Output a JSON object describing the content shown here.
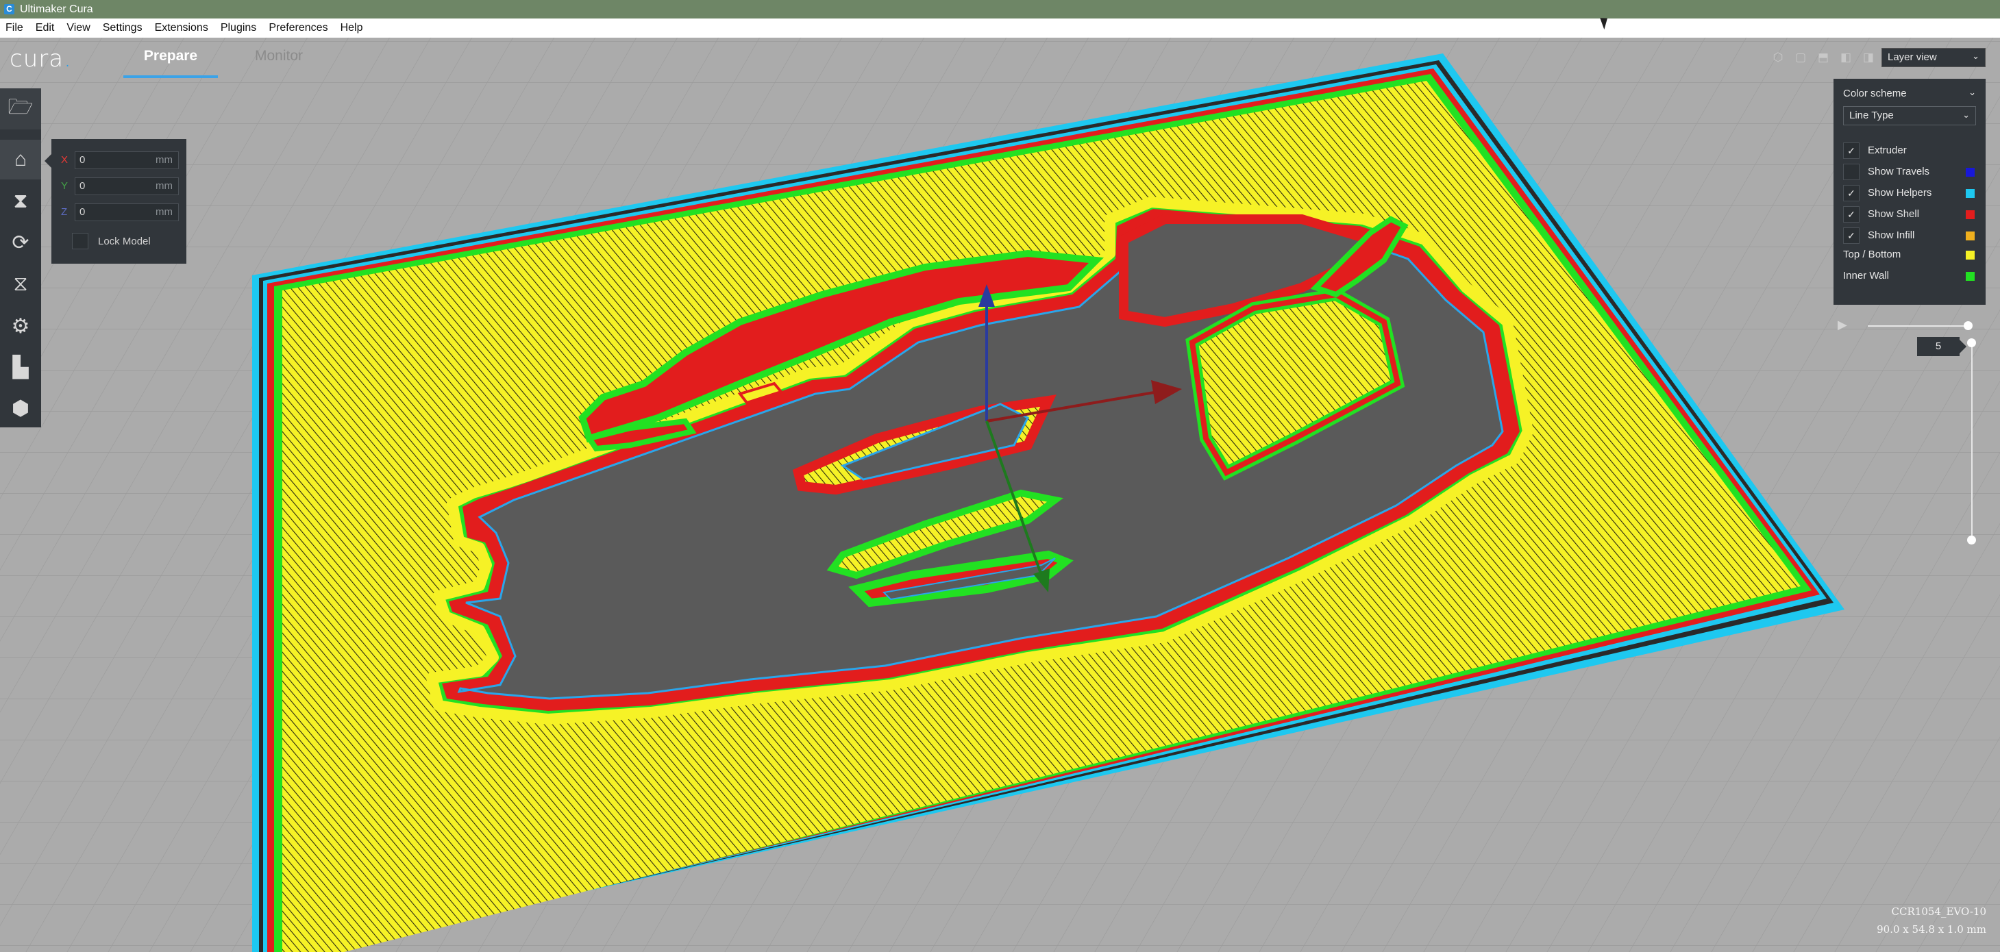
{
  "window": {
    "title": "Ultimaker Cura",
    "app_icon": "C"
  },
  "menu": [
    "File",
    "Edit",
    "View",
    "Settings",
    "Extensions",
    "Plugins",
    "Preferences",
    "Help"
  ],
  "header": {
    "logo": "cura",
    "tabs": [
      {
        "label": "Prepare",
        "active": true
      },
      {
        "label": "Monitor",
        "active": false
      }
    ]
  },
  "toolbar": {
    "tools": [
      {
        "name": "open-file",
        "icon": "folder-icon"
      },
      {
        "name": "move",
        "icon": "move-tool-icon",
        "active": true
      },
      {
        "name": "scale",
        "icon": "scale-tool-icon"
      },
      {
        "name": "rotate",
        "icon": "rotate-tool-icon"
      },
      {
        "name": "mirror",
        "icon": "mirror-tool-icon"
      },
      {
        "name": "per-model-settings",
        "icon": "per-model-settings-icon"
      },
      {
        "name": "support-blocker",
        "icon": "support-blocker-icon"
      },
      {
        "name": "print",
        "icon": "print-icon"
      }
    ]
  },
  "move_panel": {
    "x": {
      "label": "X",
      "value": "0",
      "unit": "mm",
      "color": "#e53935"
    },
    "y": {
      "label": "Y",
      "value": "0",
      "unit": "mm",
      "color": "#43a047"
    },
    "z": {
      "label": "Z",
      "value": "0",
      "unit": "mm",
      "color": "#3f51b5"
    },
    "lock_label": "Lock Model"
  },
  "view": {
    "selected": "Layer view"
  },
  "color_panel": {
    "header": "Color scheme",
    "scheme": "Line Type",
    "items": [
      {
        "label": "Extruder",
        "checked": true,
        "color": ""
      },
      {
        "label": "Show Travels",
        "checked": false,
        "color": "#1818d8"
      },
      {
        "label": "Show Helpers",
        "checked": true,
        "color": "#1ec8f0"
      },
      {
        "label": "Show Shell",
        "checked": true,
        "color": "#e21d1d"
      },
      {
        "label": "Show Infill",
        "checked": true,
        "color": "#f0b01e"
      }
    ],
    "legend": [
      {
        "label": "Top / Bottom",
        "color": "#f6f226"
      },
      {
        "label": "Inner Wall",
        "color": "#22e122"
      }
    ]
  },
  "layer_slider": {
    "current_layer": "5"
  },
  "object_info": {
    "name": "CCR1054_EVO-10",
    "dimensions": "90.0 x 54.8 x 1.0 mm"
  },
  "colors": {
    "accent": "#3ba3e8",
    "panel": "#31363b",
    "infill": "#f6f226",
    "shell": "#e21d1d",
    "inner_wall": "#22e122",
    "helpers": "#1ec8f0",
    "model": "#5a5a5a"
  }
}
